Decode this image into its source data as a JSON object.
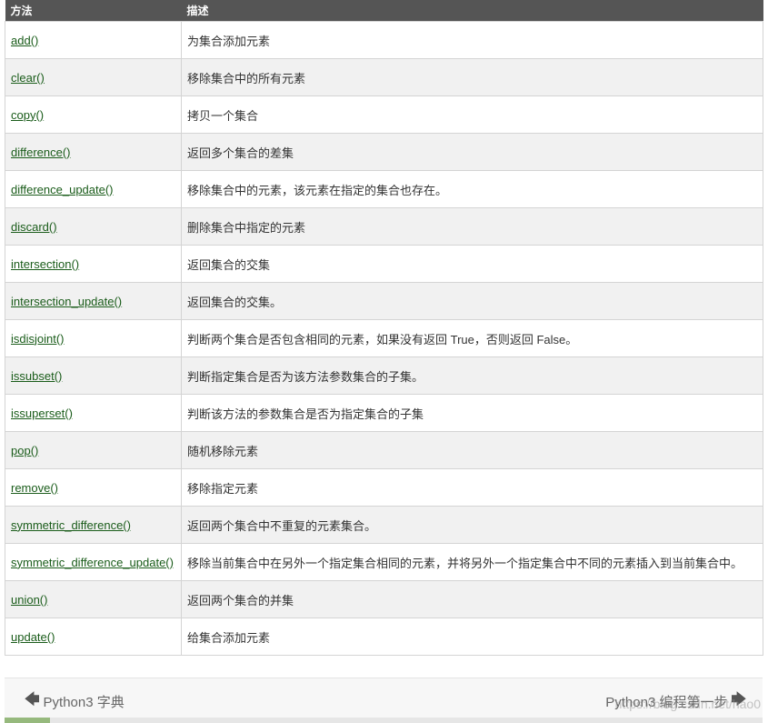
{
  "table": {
    "headers": [
      "方法",
      "描述"
    ],
    "rows": [
      {
        "method": "add()",
        "description": "为集合添加元素"
      },
      {
        "method": "clear()",
        "description": "移除集合中的所有元素"
      },
      {
        "method": "copy()",
        "description": "拷贝一个集合"
      },
      {
        "method": "difference()",
        "description": "返回多个集合的差集"
      },
      {
        "method": "difference_update()",
        "description": "移除集合中的元素，该元素在指定的集合也存在。"
      },
      {
        "method": "discard()",
        "description": "删除集合中指定的元素"
      },
      {
        "method": "intersection()",
        "description": "返回集合的交集"
      },
      {
        "method": "intersection_update()",
        "description": "返回集合的交集。"
      },
      {
        "method": "isdisjoint()",
        "description": "判断两个集合是否包含相同的元素，如果没有返回 True，否则返回 False。"
      },
      {
        "method": "issubset()",
        "description": "判断指定集合是否为该方法参数集合的子集。"
      },
      {
        "method": "issuperset()",
        "description": "判断该方法的参数集合是否为指定集合的子集"
      },
      {
        "method": "pop()",
        "description": "随机移除元素"
      },
      {
        "method": "remove()",
        "description": "移除指定元素"
      },
      {
        "method": "symmetric_difference()",
        "description": "返回两个集合中不重复的元素集合。"
      },
      {
        "method": "symmetric_difference_update()",
        "description": "移除当前集合中在另外一个指定集合相同的元素，并将另外一个指定集合中不同的元素插入到当前集合中。"
      },
      {
        "method": "union()",
        "description": "返回两个集合的并集"
      },
      {
        "method": "update()",
        "description": "给集合添加元素"
      }
    ]
  },
  "nav": {
    "prev_label": "Python3 字典",
    "next_label": "Python3 编程第一步",
    "prev_icon": "arrow-left-icon",
    "next_icon": "arrow-right-icon"
  },
  "watermark": "https://blog.csdn.net/hao0",
  "progress": {
    "fraction": 0.06
  },
  "colors": {
    "header_bg": "#555555",
    "link": "#1a5c1a",
    "alt_row": "#f1f1f1",
    "progress_fill": "#96b97d"
  }
}
